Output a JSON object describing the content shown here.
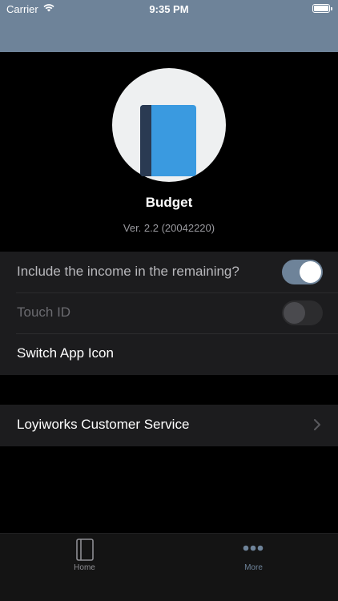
{
  "status_bar": {
    "carrier": "Carrier",
    "time": "9:35 PM",
    "icons": [
      "wifi-icon",
      "battery-icon"
    ]
  },
  "app": {
    "name": "Budget",
    "version": "Ver. 2.2 (20042220)",
    "icon": "book-icon"
  },
  "settings": {
    "include_income_label": "Include the income in the remaining?",
    "include_income_on": true,
    "touch_id_label": "Touch ID",
    "touch_id_on": false,
    "switch_icon_label": "Switch App Icon",
    "customer_service_label": "Loyiworks Customer Service"
  },
  "tabs": [
    {
      "label": "Home",
      "icon": "book-outline-icon",
      "selected": false
    },
    {
      "label": "More",
      "icon": "ellipsis-icon",
      "selected": true
    }
  ],
  "colors": {
    "accent": "#6e8399",
    "book_blue": "#3a9ae0",
    "book_spine": "#2a3a52",
    "row_bg": "#1c1c1e"
  }
}
